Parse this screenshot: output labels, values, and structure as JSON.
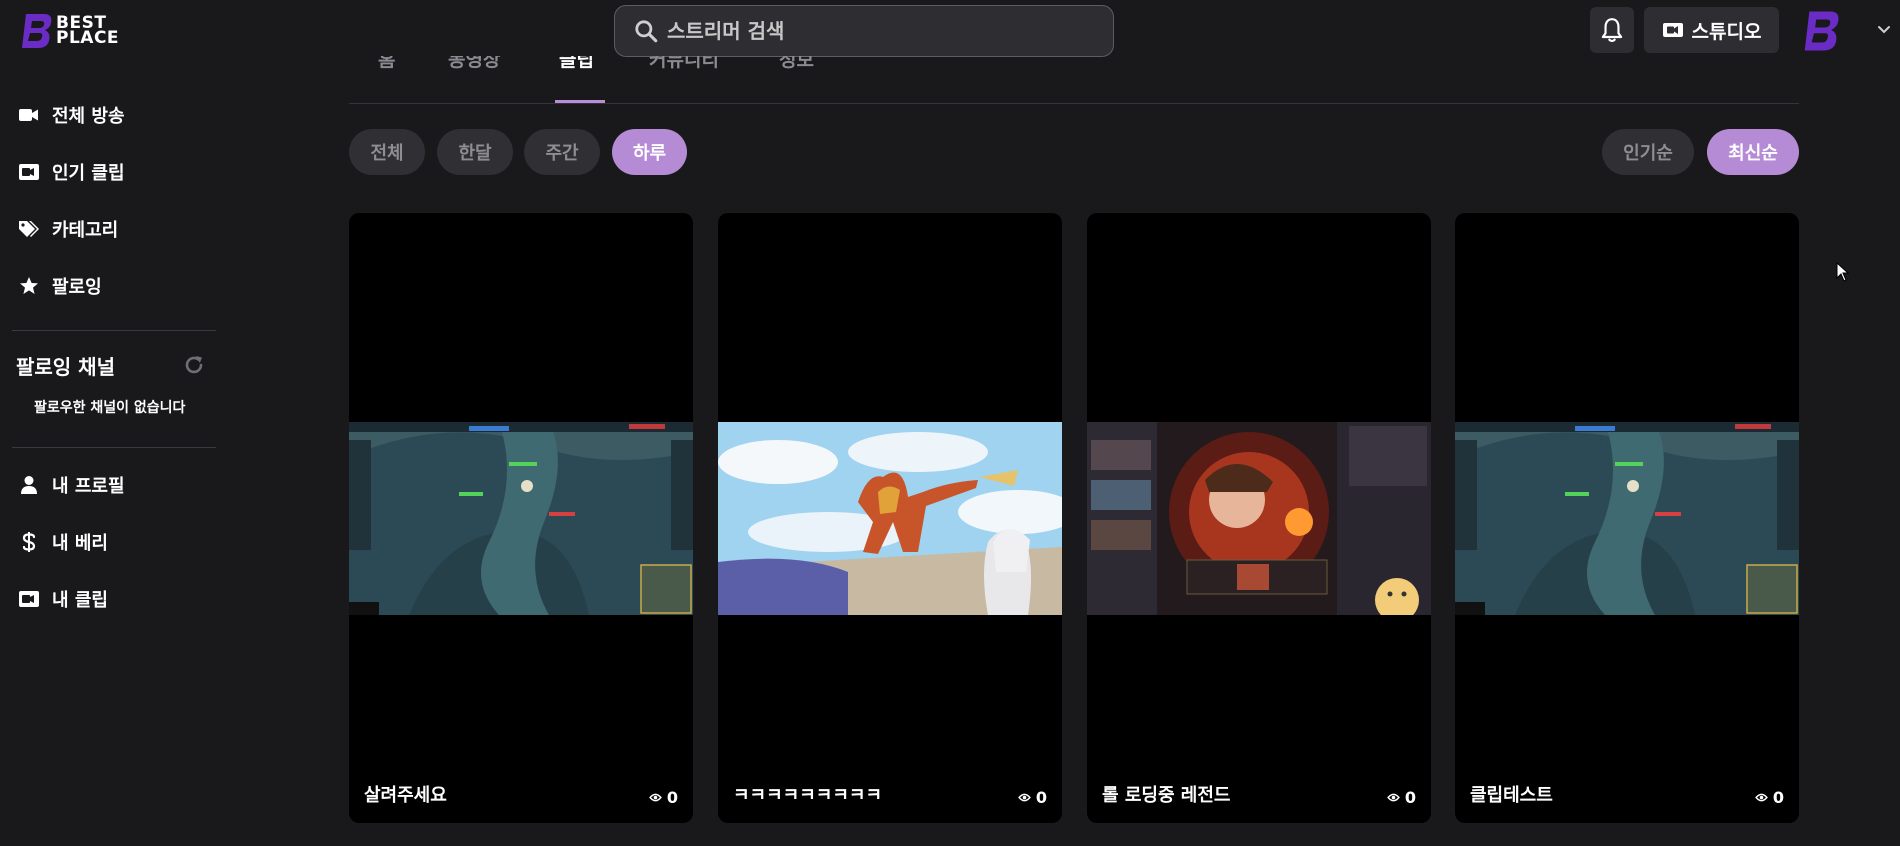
{
  "header": {
    "logo_line1": "BEST",
    "logo_line2": "PLACE",
    "search_placeholder": "스트리머 검색",
    "studio_label": "스튜디오"
  },
  "sidebar": {
    "items": [
      {
        "label": "전체 방송",
        "icon": "video-camera-icon"
      },
      {
        "label": "인기 클립",
        "icon": "clip-icon"
      },
      {
        "label": "카테고리",
        "icon": "tags-icon"
      },
      {
        "label": "팔로잉",
        "icon": "star-icon"
      }
    ],
    "following_title": "팔로잉 채널",
    "following_empty": "팔로우한 채널이 없습니다",
    "bottom_items": [
      {
        "label": "내 프로필",
        "icon": "user-icon"
      },
      {
        "label": "내 베리",
        "icon": "dollar-icon"
      },
      {
        "label": "내 클립",
        "icon": "clip-icon"
      }
    ]
  },
  "tabs": [
    "홈",
    "동영상",
    "클립",
    "커뮤니티",
    "정보"
  ],
  "active_tab": "클립",
  "filters": {
    "period": [
      "전체",
      "한달",
      "주간",
      "하루"
    ],
    "period_active": "하루",
    "sort": [
      "인기순",
      "최신순"
    ],
    "sort_active": "최신순"
  },
  "clips": [
    {
      "title": "살려주세요",
      "views": "0"
    },
    {
      "title": "ㅋㅋㅋㅋㅋㅋㅋㅋㅋ",
      "views": "0"
    },
    {
      "title": "롤 로딩중 레전드",
      "views": "0"
    },
    {
      "title": "클립테스트",
      "views": "0"
    }
  ],
  "colors": {
    "accent": "#b58bd6",
    "background": "#19191c",
    "surface": "#2d2d32"
  }
}
